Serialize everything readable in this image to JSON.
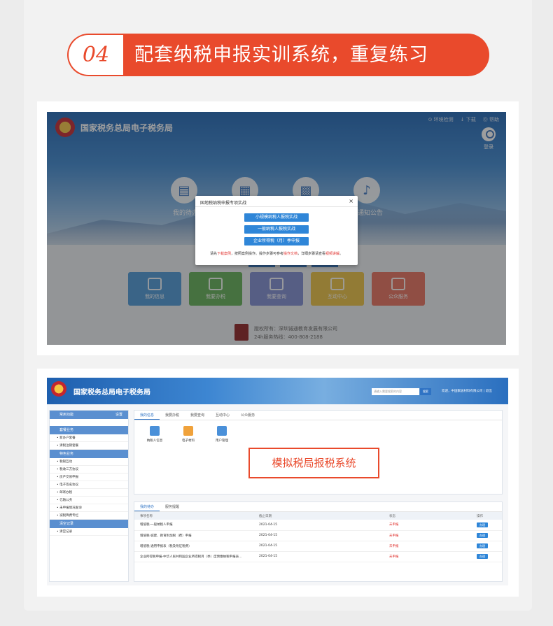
{
  "header": {
    "number": "04",
    "title": "配套纳税申报实训系统，重复练习"
  },
  "screen1": {
    "site_title": "国家税务总局电子税务局",
    "toplinks": [
      "⊙ 环境检测",
      "↓ 下载",
      "⓪ 帮助"
    ],
    "login": "登录",
    "circles": [
      {
        "label": "我的待办"
      },
      {
        "label": ""
      },
      {
        "label": ""
      },
      {
        "label": "通知公告"
      }
    ],
    "tiles": [
      {
        "label": "我的信息",
        "color": "#4a96d6"
      },
      {
        "label": "我要办税",
        "color": "#5fae54"
      },
      {
        "label": "我要查询",
        "color": "#7d8bd0"
      },
      {
        "label": "互动中心",
        "color": "#eac040"
      },
      {
        "label": "公众服务",
        "color": "#e66e5c"
      }
    ],
    "modal": {
      "title": "国地税纳税申报专项实战",
      "close": "×",
      "buttons": [
        "小规模纳税人报税实战",
        "一般纳税人报税实战",
        "企业所得税（月）季申报"
      ],
      "note_prefix": "请先",
      "note_red1": "下载案例",
      "note_mid": "，按照案例操作。操作步骤可参考",
      "note_red2": "操作文档",
      "note_mid2": "，详细步骤请查看",
      "note_red3": "视频讲解",
      "note_end": "。"
    },
    "footer": {
      "line1": "版权所有：深圳诚通教育发展有限公司",
      "line2": "24h服务热线：400-808-2188"
    }
  },
  "screen2": {
    "site_title": "国家税务总局电子税务局",
    "search_placeholder": "请输入需要搜索的内容",
    "search_btn": "搜索",
    "welcome": "欢迎，中国家居材料有限公司  |  退出",
    "sidebar": {
      "head": "常用功能",
      "head_right": "设置",
      "groups": [
        {
          "title": "套餐业务",
          "items": [
            "• 新办户套餐",
            "• 清税注销套餐"
          ]
        },
        {
          "title": "特色业务",
          "items": [
            "• 税银互动",
            "• 税收三方协议",
            "• 房产交易申报",
            "• 电子签名协议",
            "• 邮寄办税",
            "• 亿融公务",
            "• 未申报情况查询",
            "• 减税降费专栏"
          ]
        },
        {
          "title": "清空记录",
          "items": [
            "• 清空记录"
          ]
        }
      ]
    },
    "tabs": [
      "我的信息",
      "我要办税",
      "我要查询",
      "互动中心",
      "公众服务"
    ],
    "quick": [
      "纳税人信息",
      "电子材料",
      "用户管理"
    ],
    "callout": "模拟税局报税系统",
    "todo": {
      "tabs": [
        "我的待办",
        "服务提醒"
      ],
      "headers": [
        "事项名称",
        "截止日期",
        "状态",
        "操作"
      ],
      "rows": [
        {
          "name": "增值税-一般纳税人申报",
          "date": "2021-04-15",
          "status": "未申报",
          "action": "办理"
        },
        {
          "name": "增值税-城建、教育附加税（费）申报",
          "date": "2021-04-15",
          "status": "未申报",
          "action": "办理"
        },
        {
          "name": "增值税-通用申报表（税及附征税费）",
          "date": "2021-04-15",
          "status": "未申报",
          "action": "办理"
        },
        {
          "name": "企业所得税申报-中华人民共和国企业所得税月（季）度预缴纳税申报表...",
          "date": "2021-04-15",
          "status": "未申报",
          "action": "办理"
        }
      ]
    }
  }
}
